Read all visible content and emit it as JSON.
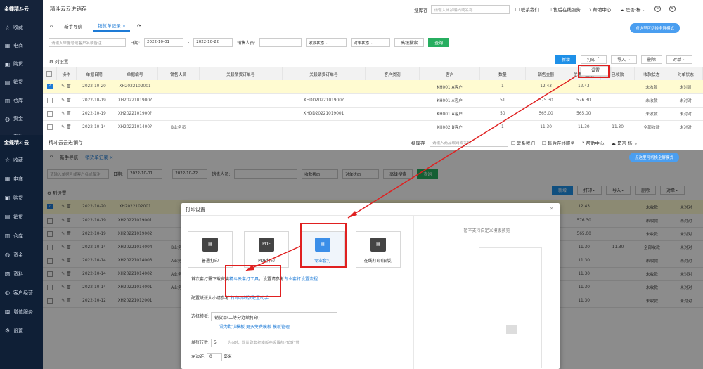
{
  "app": {
    "logo": "金蝶精斗云",
    "title": "精斗云云进销存",
    "search_label": "搜库存",
    "search_placeholder": "请输入商品编码或名称",
    "links": [
      "联系我们",
      "售后在线服务",
      "帮助中心"
    ],
    "user": "是否·杨"
  },
  "sidebar_a": [
    "收藏",
    "电商",
    "购货",
    "销货",
    "仓库",
    "资金",
    "资料"
  ],
  "sidebar_b": [
    "收藏",
    "电商",
    "购货",
    "销货",
    "仓库",
    "资金",
    "资料",
    "客户经营",
    "增值服务",
    "设置"
  ],
  "tabs": [
    "新手导航",
    "销货单记录"
  ],
  "filters": {
    "keyword_placeholder": "请输入单据号或客户名或备注",
    "date_label": "日期:",
    "date_from": "2022-10-01",
    "date_to": "2022-10-22",
    "date_to_b": "2022-10-22",
    "sales_label": "销售人员:",
    "status_label": "收款状态",
    "check_label": "对单状态",
    "advanced": "高级搜索",
    "query": "查询"
  },
  "toolbar": {
    "col_settings": "列设置",
    "new": "新增",
    "print": "打印",
    "import": "导入",
    "delete": "删除",
    "check": "对单",
    "dropdown_item": "设置"
  },
  "table_headers": [
    "操作",
    "单据日期",
    "单据编号",
    "销售人员",
    "关联销货订单号",
    "关联销货订单号",
    "客户类别",
    "客户",
    "数量",
    "销售金额",
    "优惠后金额",
    "已收款",
    "收款状态",
    "对单状态"
  ],
  "rows": [
    {
      "date": "2022-10-20",
      "no": "XH2022102001",
      "sales": "",
      "order": "",
      "client": "KH001 A客户",
      "qty": "1",
      "amount": "12.43",
      "after": "12.43",
      "received": "",
      "status": "未收款",
      "check": "未对对"
    },
    {
      "date": "2022-10-19",
      "no": "XH2022101900?",
      "sales": "",
      "order": "XHDD2022101900?",
      "client": "KH001 A客户",
      "qty": "51",
      "amount": "575.30",
      "after": "576.30",
      "received": "",
      "status": "未收款",
      "check": "未对对"
    },
    {
      "date": "2022-10-19",
      "no": "XH2022101900?",
      "sales": "",
      "order": "XHDD20221019001",
      "client": "KH001 A客户",
      "qty": "50",
      "amount": "565.00",
      "after": "565.00",
      "received": "",
      "status": "未收款",
      "check": "未对对"
    },
    {
      "date": "2022-10-14",
      "no": "XH2022101400?",
      "sales": "B业务员",
      "order": "",
      "client": "KH002 B客户",
      "qty": "1",
      "amount": "11.30",
      "after": "11.30",
      "received": "11.30",
      "status": "全部收款",
      "check": "未对对"
    }
  ],
  "rows_b": [
    {
      "date": "2022-10-20",
      "no": "XH2022102001",
      "sales": "",
      "after": "12.43",
      "received": "",
      "status": "未收款",
      "check": "未对对"
    },
    {
      "date": "2022-10-19",
      "no": "XH20221019001",
      "sales": "",
      "after": "576.30",
      "received": "",
      "status": "未收款",
      "check": "未对对"
    },
    {
      "date": "2022-10-19",
      "no": "XH20221019002",
      "sales": "",
      "after": "565.00",
      "received": "",
      "status": "未收款",
      "check": "未对对"
    },
    {
      "date": "2022-10-14",
      "no": "XH20221014004",
      "sales": "B业务员",
      "after": "11.30",
      "received": "11.30",
      "status": "全部收款",
      "check": "未对对"
    },
    {
      "date": "2022-10-14",
      "no": "XH20221014003",
      "sales": "A业务员",
      "after": "11.30",
      "received": "",
      "status": "未收款",
      "check": "未对对"
    },
    {
      "date": "2022-10-14",
      "no": "XH20221014002",
      "sales": "A业务员",
      "after": "11.30",
      "received": "",
      "status": "未收款",
      "check": "未对对"
    },
    {
      "date": "2022-10-14",
      "no": "XH20221014001",
      "sales": "A业务员",
      "after": "11.30",
      "received": "",
      "status": "未收款",
      "check": "未对对"
    },
    {
      "date": "2022-10-12",
      "no": "XH20221012001",
      "sales": "",
      "after": "11.30",
      "received": "",
      "status": "未收款",
      "check": "未对对"
    }
  ],
  "tooltip": "点这里可切换全屏模式",
  "dialog": {
    "title": "打印设置",
    "tiles": [
      "普通打印",
      "PDF打印",
      "专业套打",
      "在线打印(旧版)"
    ],
    "line1_pre": "首次套打需下载安装",
    "line1_link": "精斗云套打工具",
    "line1_mid": "，设置请参考",
    "line1_link2": "专业套打设置流程",
    "line2_pre": "配置纸张大小请参考",
    "line2_link": "打印机纸张配置助手",
    "template_label": "选择模板:",
    "template_value": "销货单(二等分连续打印)",
    "template_links": "设为默认模板  更多免费模板  模板管理",
    "rows_label": "单张行数:",
    "rows_value": "5",
    "rows_hint": "为0时，默认取套打模板中设置的打印行数",
    "left_label": "左边距:",
    "left_value": "0",
    "left_unit": "毫米",
    "preview_text": "暂不支持自定义模板预览"
  }
}
